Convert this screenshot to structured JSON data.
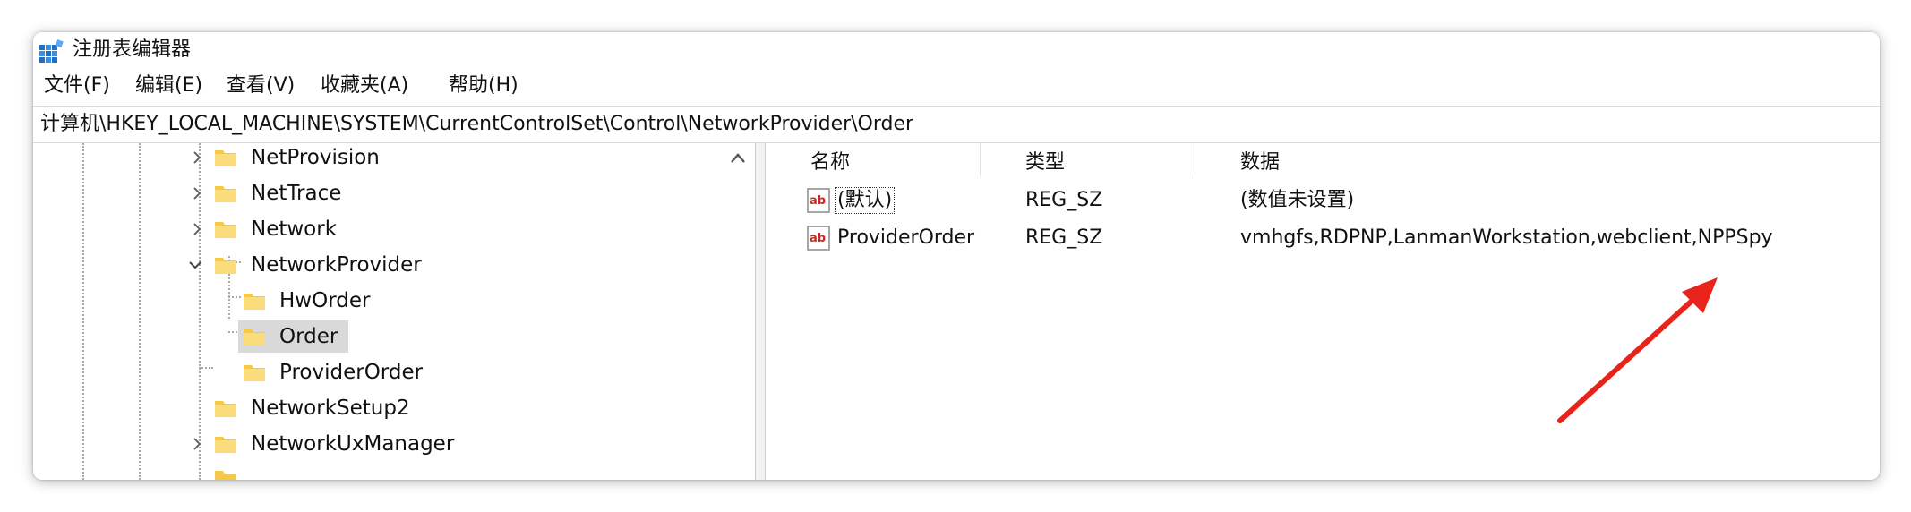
{
  "window": {
    "title": "注册表编辑器",
    "app_icon": "registry-editor-icon"
  },
  "menu": {
    "items": [
      "文件(F)",
      "编辑(E)",
      "查看(V)",
      "收藏夹(A)",
      "帮助(H)"
    ]
  },
  "address": {
    "path": "计算机\\HKEY_LOCAL_MACHINE\\SYSTEM\\CurrentControlSet\\Control\\NetworkProvider\\Order"
  },
  "tree": {
    "items": [
      {
        "label": "NetProvision",
        "expander": "collapsed"
      },
      {
        "label": "NetTrace",
        "expander": "collapsed"
      },
      {
        "label": "Network",
        "expander": "collapsed"
      },
      {
        "label": "NetworkProvider",
        "expander": "expanded"
      },
      {
        "label": "HwOrder",
        "expander": "none"
      },
      {
        "label": "Order",
        "expander": "none",
        "selected": true
      },
      {
        "label": "ProviderOrder",
        "expander": "none"
      },
      {
        "label": "NetworkSetup2",
        "expander": "none"
      },
      {
        "label": "NetworkUxManager",
        "expander": "collapsed"
      }
    ]
  },
  "list": {
    "headers": [
      "名称",
      "类型",
      "数据"
    ],
    "rows": [
      {
        "name": "(默认)",
        "type": "REG_SZ",
        "data": "(数值未设置)",
        "icon": "string-value-icon"
      },
      {
        "name": "ProviderOrder",
        "type": "REG_SZ",
        "data": "vmhgfs,RDPNP,LanmanWorkstation,webclient,NPPSpy",
        "icon": "string-value-icon"
      }
    ]
  },
  "annotation": {
    "arrow_color": "#e8231a"
  }
}
